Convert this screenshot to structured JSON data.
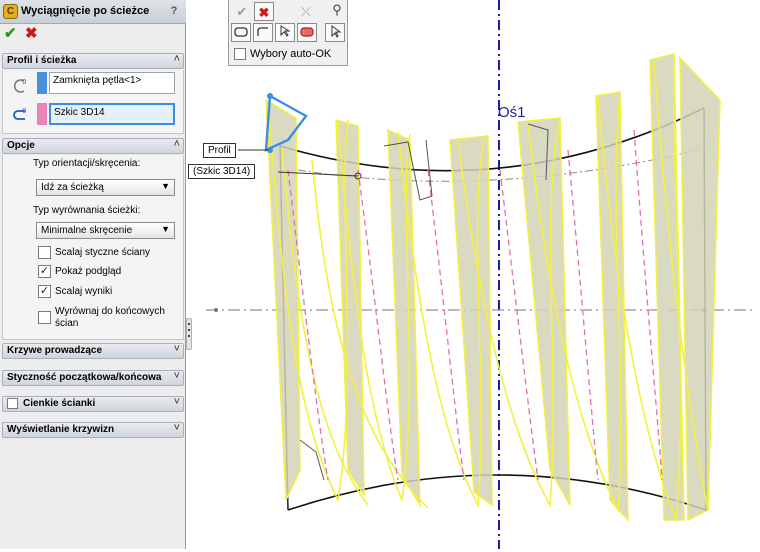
{
  "property_manager": {
    "title": "Wyciągnięcie po ścieżce",
    "help_icon": "?",
    "ok_icon": "checkmark-icon",
    "cancel_icon": "x-icon",
    "sections": {
      "profile_path": {
        "header": "Profil i ścieżka",
        "profile_value": "Zamknięta pętla<1>",
        "path_value": "Szkic 3D14",
        "profile_color": "#4a90d9",
        "path_color": "#e884b4"
      },
      "options": {
        "header": "Opcje",
        "orientation_label": "Typ orientacji/skręcenia:",
        "orientation_value": "Idź za ścieżką",
        "alignment_label": "Typ wyrównania ścieżki:",
        "alignment_value": "Minimalne skręcenie",
        "checkboxes": [
          {
            "label": "Scalaj styczne ściany",
            "checked": false,
            "mark": ""
          },
          {
            "label": "Pokaż podgląd",
            "checked": true,
            "mark": "✓"
          },
          {
            "label": "Scalaj wyniki",
            "checked": true,
            "mark": "✓"
          },
          {
            "label": "Wyrównaj do końcowych ścian",
            "checked": false,
            "mark": ""
          }
        ]
      },
      "guide_curves": {
        "header": "Krzywe prowadzące"
      },
      "tangency": {
        "header": "Styczność początkowa/końcowa"
      },
      "thin": {
        "header": "Cienkie ścianki"
      },
      "curvature": {
        "header": "Wyświetlanie krzywizn"
      }
    }
  },
  "selection_toolbar": {
    "auto_ok_label": "Wybory auto-OK"
  },
  "viewport": {
    "axis_label": "Oś1",
    "callout_profile": "Profil",
    "callout_path": "(Szkic 3D14)"
  },
  "colors": {
    "preview_edge": "#f2f040",
    "preview_fill": "#d4d3b8",
    "path_dash": "#e070b0",
    "axis": "#1a1aa8",
    "profile_highlight": "#3a8ee6"
  }
}
